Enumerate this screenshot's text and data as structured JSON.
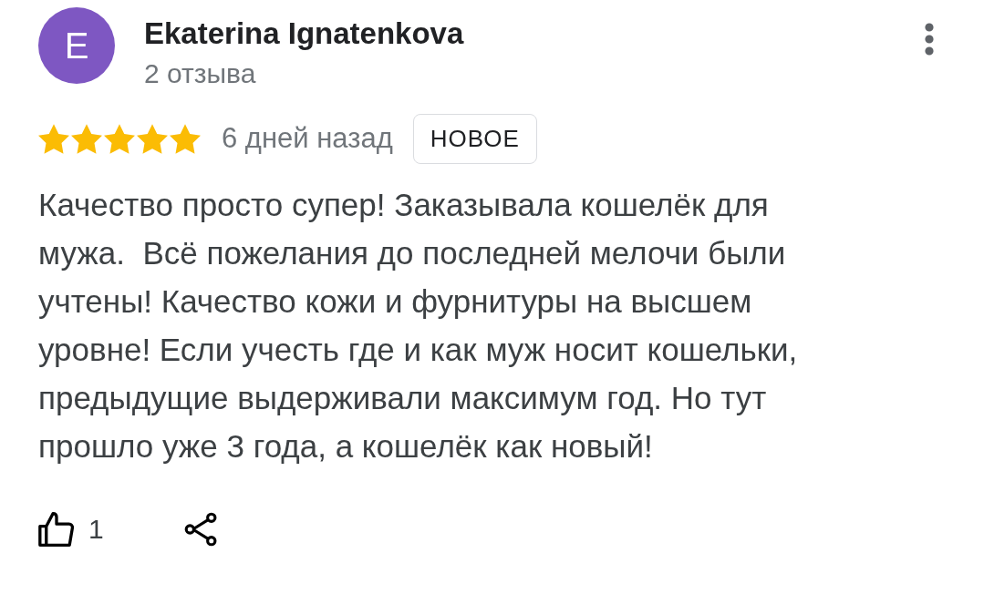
{
  "review": {
    "avatar_letter": "E",
    "author": "Ekaterina Ignatenkova",
    "review_count": "2 отзыва",
    "stars": 5,
    "time": "6 дней назад",
    "badge": "НОВОЕ",
    "text": "Качество просто супер! Заказывала кошелёк для мужа.  Всё пожелания до последней мелочи были учтены! Качество кожи и фурнитуры на высшем уровне! Если учесть где и как муж носит кошельки, предыдущие выдерживали максимум год. Но тут прошло уже 3 года, а кошелёк как новый!",
    "likes": "1"
  }
}
